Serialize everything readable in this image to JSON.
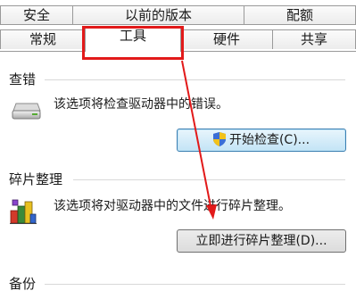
{
  "tabs": {
    "row1": [
      "安全",
      "以前的版本",
      "配额"
    ],
    "row2": [
      "常规",
      "工具",
      "硬件",
      "共享"
    ],
    "active": "工具"
  },
  "error_check": {
    "title": "查错",
    "description": "该选项将检查驱动器中的错误。",
    "button_label": "开始检查(C)...",
    "icon": "drive-icon"
  },
  "defrag": {
    "title": "碎片整理",
    "description": "该选项将对驱动器中的文件进行碎片整理。",
    "button_label": "立即进行碎片整理(D)...",
    "icon": "defrag-icon"
  },
  "backup": {
    "title": "备份"
  },
  "colors": {
    "highlight": "#e21a1a",
    "focused_button": "#c3e4f6"
  }
}
